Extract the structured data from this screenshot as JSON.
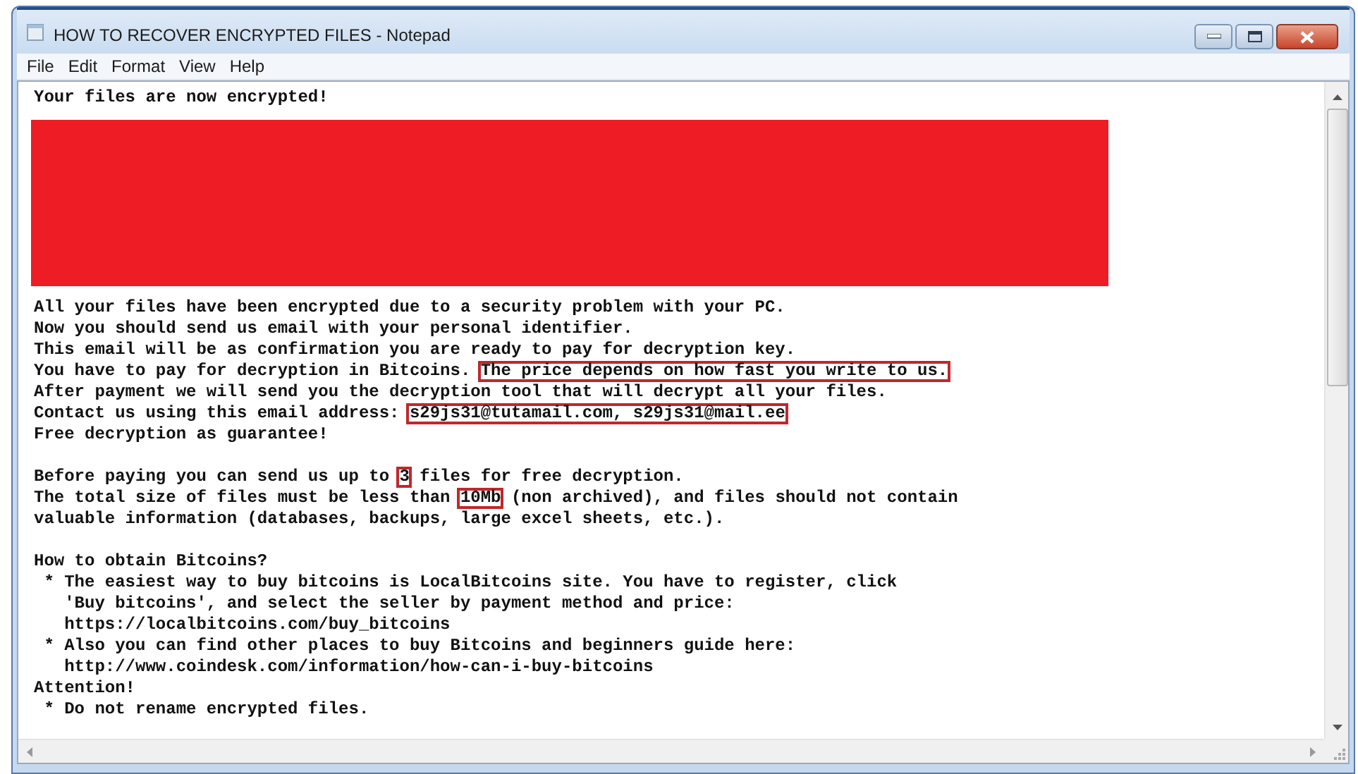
{
  "window": {
    "title": "HOW TO RECOVER ENCRYPTED FILES - Notepad"
  },
  "menu": [
    "File",
    "Edit",
    "Format",
    "View",
    "Help"
  ],
  "document": {
    "lines": [
      {
        "kind": "text",
        "segments": [
          {
            "text": "Your files are now encrypted!",
            "boxed": false
          }
        ]
      },
      {
        "kind": "redaction"
      },
      {
        "kind": "text",
        "segments": [
          {
            "text": "All your files have been encrypted due to a security problem with your PC.",
            "boxed": false
          }
        ]
      },
      {
        "kind": "text",
        "segments": [
          {
            "text": "Now you should send us email with your personal identifier.",
            "boxed": false
          }
        ]
      },
      {
        "kind": "text",
        "segments": [
          {
            "text": "This email will be as confirmation you are ready to pay for decryption key.",
            "boxed": false
          }
        ]
      },
      {
        "kind": "text",
        "segments": [
          {
            "text": "You have to pay for decryption in Bitcoins. ",
            "boxed": false
          },
          {
            "text": "The price depends on how fast you write to us.",
            "boxed": true
          }
        ]
      },
      {
        "kind": "text",
        "segments": [
          {
            "text": "After payment we will send you the decryption tool that will decrypt all your files.",
            "boxed": false
          }
        ]
      },
      {
        "kind": "text",
        "segments": [
          {
            "text": "Contact us using this email address: ",
            "boxed": false
          },
          {
            "text": "s29js31@tutamail.com, s29js31@mail.ee",
            "boxed": true
          }
        ]
      },
      {
        "kind": "text",
        "segments": [
          {
            "text": "Free decryption as guarantee!",
            "boxed": false
          }
        ]
      },
      {
        "kind": "blank"
      },
      {
        "kind": "text",
        "segments": [
          {
            "text": "Before paying you can send us up to ",
            "boxed": false
          },
          {
            "text": "3",
            "boxed": true
          },
          {
            "text": " files for free decryption.",
            "boxed": false
          }
        ]
      },
      {
        "kind": "text",
        "segments": [
          {
            "text": "The total size of files must be less than ",
            "boxed": false
          },
          {
            "text": "10Mb",
            "boxed": true
          },
          {
            "text": " (non archived), and files should not contain",
            "boxed": false
          }
        ]
      },
      {
        "kind": "text",
        "segments": [
          {
            "text": "valuable information (databases, backups, large excel sheets, etc.).",
            "boxed": false
          }
        ]
      },
      {
        "kind": "blank"
      },
      {
        "kind": "text",
        "segments": [
          {
            "text": "How to obtain Bitcoins?",
            "boxed": false
          }
        ]
      },
      {
        "kind": "text",
        "segments": [
          {
            "text": " * The easiest way to buy bitcoins is LocalBitcoins site. You have to register, click",
            "boxed": false
          }
        ]
      },
      {
        "kind": "text",
        "segments": [
          {
            "text": "   'Buy bitcoins', and select the seller by payment method and price:",
            "boxed": false
          }
        ]
      },
      {
        "kind": "text",
        "segments": [
          {
            "text": "   https://localbitcoins.com/buy_bitcoins",
            "boxed": false
          }
        ]
      },
      {
        "kind": "text",
        "segments": [
          {
            "text": " * Also you can find other places to buy Bitcoins and beginners guide here:",
            "boxed": false
          }
        ]
      },
      {
        "kind": "text",
        "segments": [
          {
            "text": "   http://www.coindesk.com/information/how-can-i-buy-bitcoins",
            "boxed": false
          }
        ]
      },
      {
        "kind": "text",
        "segments": [
          {
            "text": "Attention!",
            "boxed": false
          }
        ]
      },
      {
        "kind": "text",
        "segments": [
          {
            "text": " * Do not rename encrypted files.",
            "boxed": false
          }
        ]
      }
    ]
  }
}
